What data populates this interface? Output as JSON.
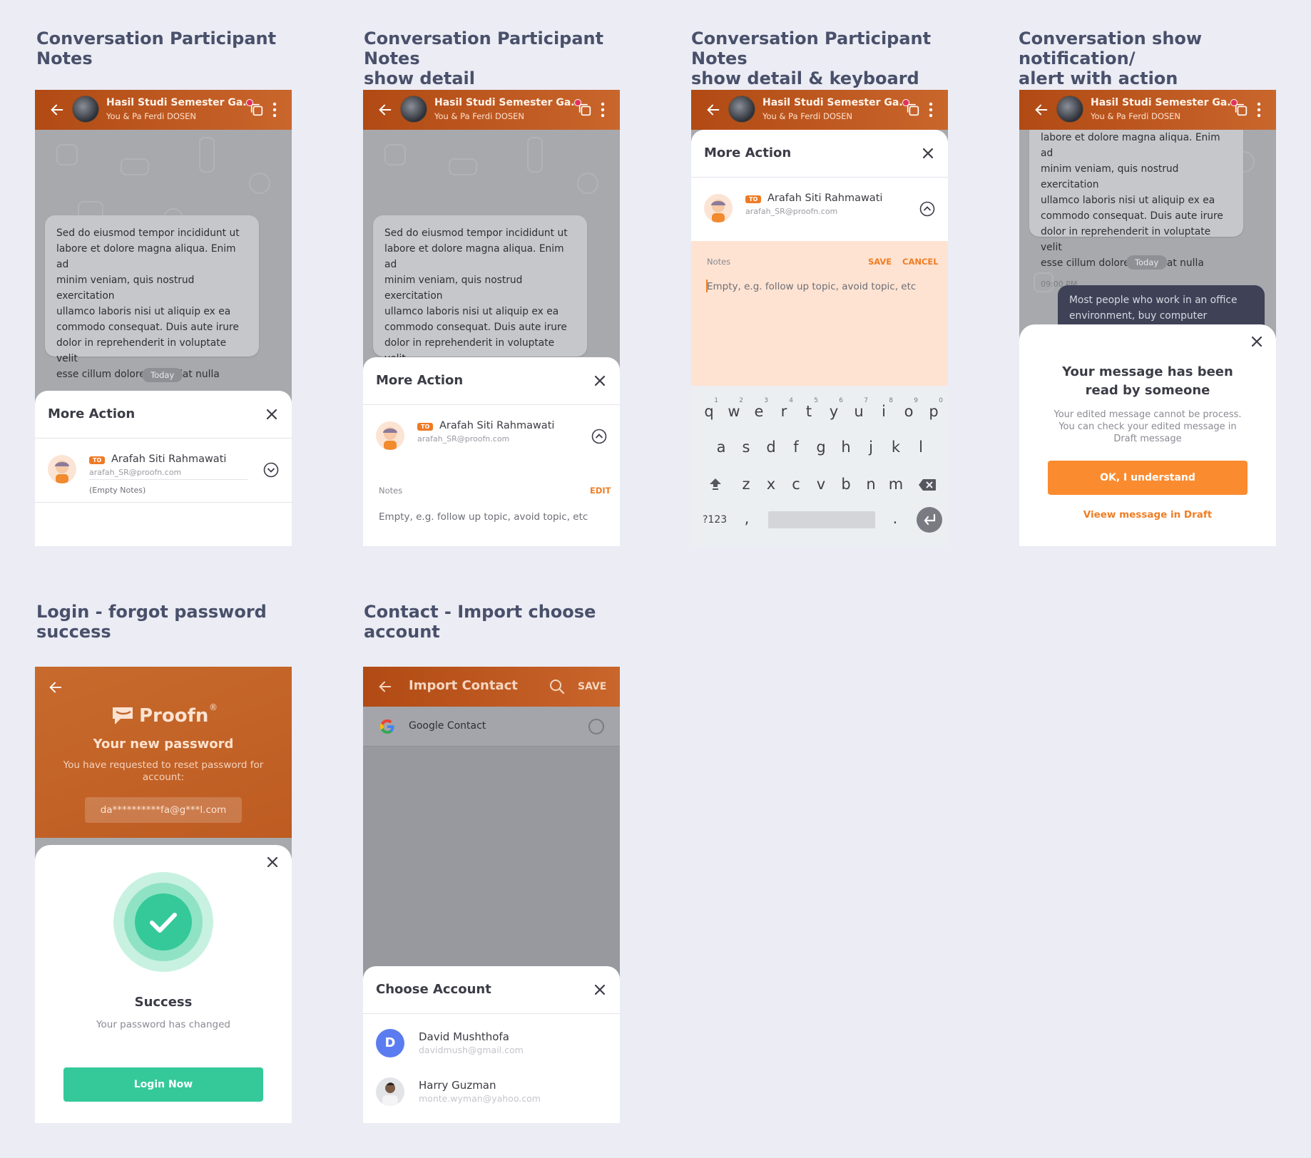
{
  "titles": {
    "s1": "Conversation Participant Notes",
    "s2_l1": "Conversation Participant Notes",
    "s2_l2": "show detail",
    "s3_l1": "Conversation Participant Notes",
    "s3_l2": "show detail & keyboard",
    "s4_l1": "Conversation show notification/",
    "s4_l2": "alert with action",
    "s5_l1": "Login - forgot password",
    "s5_l2": "success",
    "s6_l1": "Contact - Import choose",
    "s6_l2": "account"
  },
  "chat_header": {
    "group_name": "Hasil Studi Semester Ga..",
    "members": "You & Pa Ferdi DOSEN"
  },
  "message": {
    "lines": [
      "Sed do eiusmod tempor incididunt ut",
      "labore et dolore magna aliqua. Enim ad",
      "minim veniam, quis nostrud exercitation",
      "ullamco laboris nisi ut aliquip ex ea",
      "commodo consequat. Duis aute irure",
      "dolor in reprehenderit in voluptate velit",
      "esse cillum dolore eu fugiat nulla"
    ],
    "time": "09:00 PM"
  },
  "today_label": "Today",
  "sheet": {
    "title": "More Action",
    "to_badge": "TO",
    "participant_name": "Arafah Siti Rahmawati",
    "participant_email": "arafah_SR@proofn.com",
    "empty_notes": "(Empty Notes)",
    "notes_label": "Notes",
    "edit": "EDIT",
    "save": "SAVE",
    "cancel": "CANCEL",
    "notes_placeholder": "Empty, e.g. follow up topic, avoid topic, etc"
  },
  "keyboard": {
    "row1": [
      "q",
      "w",
      "e",
      "r",
      "t",
      "y",
      "u",
      "i",
      "o",
      "p"
    ],
    "row1_nums": [
      "1",
      "2",
      "3",
      "4",
      "5",
      "6",
      "7",
      "8",
      "9",
      "0"
    ],
    "row2": [
      "a",
      "s",
      "d",
      "f",
      "g",
      "h",
      "j",
      "k",
      "l"
    ],
    "row3": [
      "z",
      "x",
      "c",
      "v",
      "b",
      "n",
      "m"
    ],
    "sym": "?123",
    "comma": ",",
    "period": "."
  },
  "alert": {
    "message_partial_lines": [
      "labore et dolore magna aliqua. Enim ad",
      "minim veniam, quis nostrud exercitation",
      "ullamco laboris nisi ut aliquip ex ea",
      "commodo consequat. Duis aute irure",
      "dolor in reprehenderit in voluptate velit",
      "esse cillum dolore eu fugiat nulla"
    ],
    "outgoing_line1": "Most people who work in an office",
    "outgoing_line2": "environment, buy computer products.",
    "title_l1": "Your message has been",
    "title_l2": "read by someone",
    "body_l1": "Your edited message cannot be process.",
    "body_l2": "You can check your edited message in",
    "body_l3": "Draft message",
    "primary": "OK, I understand",
    "secondary": "Vieew message in Draft"
  },
  "login": {
    "brand": "Proofn",
    "reg": "®",
    "heading": "Your new password",
    "sub_l1": "You have requested to reset password for",
    "sub_l2": "account:",
    "masked_email": "da**********fa@g***l.com",
    "success_title": "Success",
    "success_sub": "Your password has changed",
    "button": "Login Now"
  },
  "import": {
    "title": "Import Contact",
    "save": "SAVE",
    "google_contact": "Google Contact",
    "sheet_title": "Choose Account",
    "accounts": [
      {
        "initial": "D",
        "name": "David Mushthofa",
        "email": "davidmush@gmail.com"
      },
      {
        "initial": "",
        "name": "Harry Guzman",
        "email": "monte.wyman@yahoo.com"
      }
    ]
  },
  "colors": {
    "brand_orange": "#f07d23",
    "header_gradient_start": "#b14a14",
    "success_green": "#35c99a",
    "account_blue": "#5b7cf0",
    "page_bg": "#ebecf4"
  }
}
